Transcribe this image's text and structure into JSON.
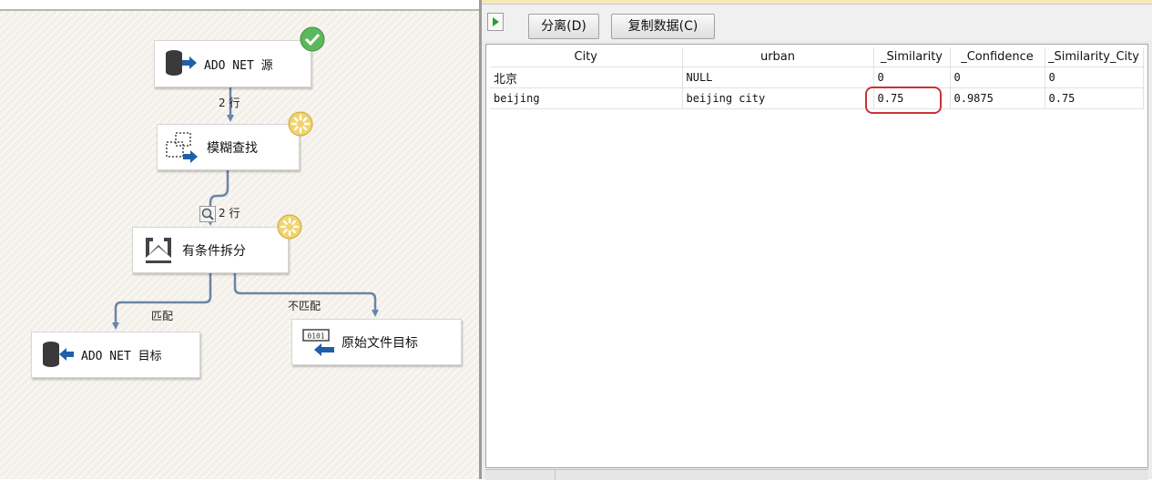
{
  "designer": {
    "nodes": [
      {
        "id": "ado_source",
        "label": "ADO NET 源",
        "icon": "database-source-icon",
        "status": "success"
      },
      {
        "id": "fuzzy_lookup",
        "label": "模糊查找",
        "icon": "fuzzy-lookup-icon",
        "status": "running"
      },
      {
        "id": "conditional_split",
        "label": "有条件拆分",
        "icon": "conditional-split-icon",
        "status": "running"
      },
      {
        "id": "ado_target",
        "label": "ADO NET 目标",
        "icon": "database-destination-icon",
        "status": "none"
      },
      {
        "id": "raw_target",
        "label": "原始文件目标",
        "icon": "raw-file-destination-icon",
        "status": "none"
      }
    ],
    "flows": [
      {
        "from": "ado_source",
        "to": "fuzzy_lookup",
        "label": "2 行"
      },
      {
        "from": "fuzzy_lookup",
        "to": "conditional_split",
        "label": "2 行",
        "has_data_viewer": true
      },
      {
        "from": "conditional_split",
        "to": "ado_target",
        "label": "匹配"
      },
      {
        "from": "conditional_split",
        "to": "raw_target",
        "label": "不匹配"
      }
    ]
  },
  "viewer": {
    "toolbar": {
      "play_icon": "play-icon",
      "detach_label": "分离(D)",
      "copy_label": "复制数据(C)"
    },
    "columns": [
      "City",
      "urban",
      "_Similarity",
      "_Confidence",
      "_Similarity_City"
    ],
    "rows": [
      [
        "北京",
        "NULL",
        "0",
        "0",
        "0"
      ],
      [
        "beijing",
        "beijing city",
        "0.75",
        "0.9875",
        "0.75"
      ]
    ],
    "highlighted_cell": {
      "row": 1,
      "column": "_Similarity",
      "color": "#c8323a"
    }
  },
  "colors": {
    "connector": "#6a84a8",
    "success_badge": "#5cb85c",
    "running_badge": "#f1d36a",
    "canvas_bg": "#f3efe9"
  }
}
